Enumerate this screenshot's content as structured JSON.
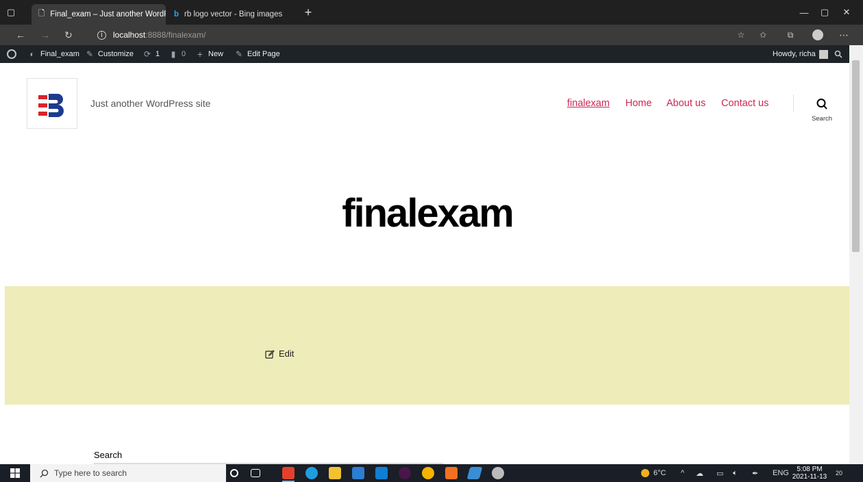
{
  "browser": {
    "tabs": [
      {
        "title": "Final_exam – Just another WordF",
        "close": "✕",
        "active": true
      },
      {
        "title": "rb logo vector - Bing images",
        "close": "✕",
        "active": false
      }
    ],
    "new_tab": "+",
    "url_host": "localhost",
    "url_path": ":8888/finalexam/",
    "window_controls": {
      "minimize": "—",
      "maximize": "▢",
      "close": "✕"
    }
  },
  "admin_bar": {
    "site_name": "Final_exam",
    "customize": "Customize",
    "updates_count": "1",
    "comments_count": "0",
    "new_label": "New",
    "edit_page": "Edit Page",
    "howdy": "Howdy, richa"
  },
  "site": {
    "tagline": "Just another WordPress site",
    "menu": [
      {
        "label": "finalexam",
        "current": true
      },
      {
        "label": "Home",
        "current": false
      },
      {
        "label": "About us",
        "current": false
      },
      {
        "label": "Contact us",
        "current": false
      }
    ],
    "search_label": "Search",
    "accent_color": "#cd2653"
  },
  "page": {
    "title": "finalexam",
    "edit_label": "Edit",
    "entry_bg": "#eeecb8"
  },
  "footer": {
    "widget_search_title": "Search"
  },
  "taskbar": {
    "search_placeholder": "Type here to search",
    "weather": "6°C",
    "language": "ENG",
    "time": "5:08 PM",
    "date": "2021-11-13",
    "notifications": "20"
  }
}
